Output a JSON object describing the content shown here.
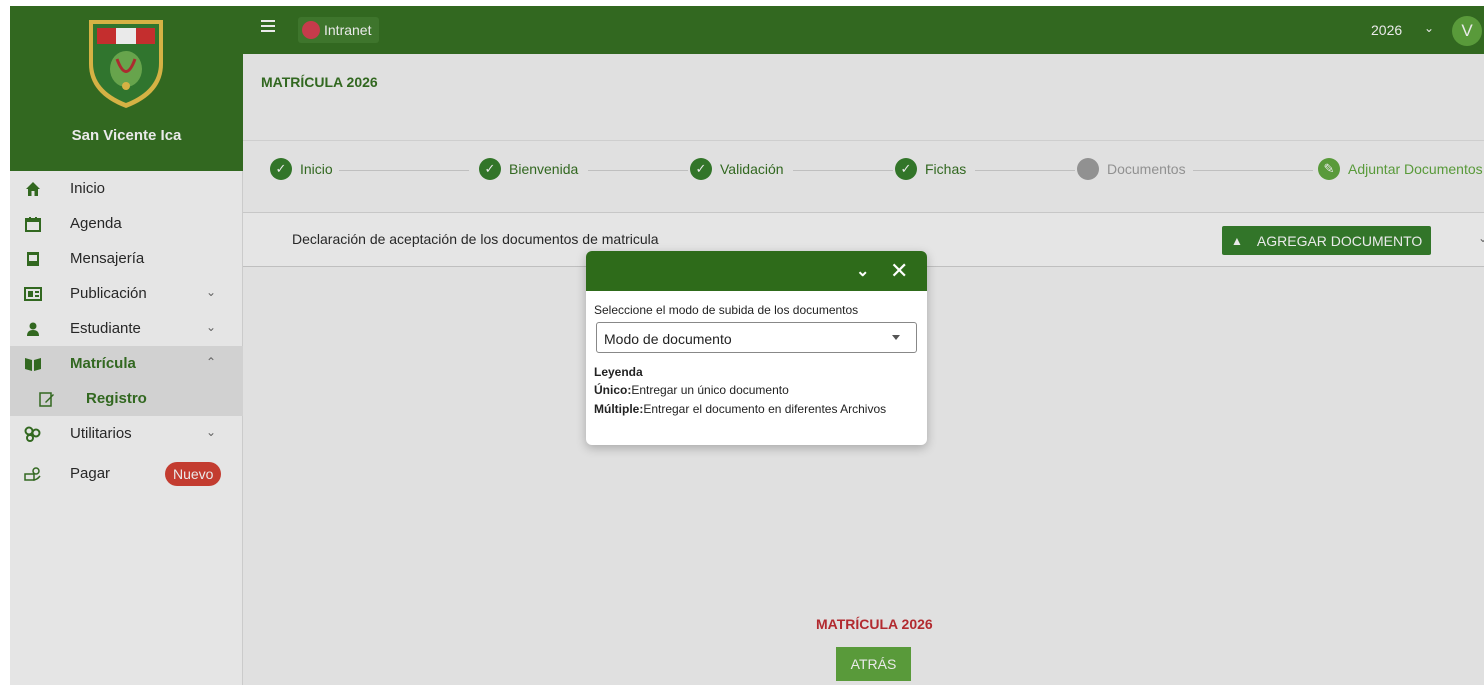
{
  "app": {
    "school_name": "San Vicente Ica",
    "intranet_label": "Intranet",
    "year": "2026",
    "avatar_initial": "V"
  },
  "sidebar": {
    "items": [
      {
        "label": "Inicio",
        "icon": "home-icon"
      },
      {
        "label": "Agenda",
        "icon": "calendar-icon"
      },
      {
        "label": "Mensajería",
        "icon": "mail-icon"
      },
      {
        "label": "Publicación",
        "icon": "news-icon"
      },
      {
        "label": "Estudiante",
        "icon": "student-icon"
      },
      {
        "label": "Matrícula",
        "icon": "book-icon"
      },
      {
        "label": "Registro",
        "icon": "edit-icon"
      },
      {
        "label": "Utilitarios",
        "icon": "tools-icon"
      },
      {
        "label": "Pagar",
        "icon": "payment-icon"
      }
    ],
    "pay_badge": "Nuevo"
  },
  "page": {
    "title": "MATRÍCULA 2026",
    "footer_title": "MATRÍCULA 2026",
    "back_button": "ATRÁS"
  },
  "steps": [
    {
      "label": "Inicio",
      "status": "done"
    },
    {
      "label": "Bienvenida",
      "status": "done"
    },
    {
      "label": "Validación",
      "status": "done"
    },
    {
      "label": "Fichas",
      "status": "done"
    },
    {
      "label": "Documentos",
      "status": "pending"
    },
    {
      "label": "Adjuntar Documentos",
      "status": "current"
    }
  ],
  "document_row": {
    "text": "Declaración de aceptación de los documentos de matricula",
    "add_button": "AGREGAR DOCUMENTO"
  },
  "modal": {
    "prompt": "Seleccione el modo de subida de los documentos",
    "select_value": "Modo de documento",
    "legend_title": "Leyenda",
    "legend": [
      {
        "term": "Único:",
        "desc": "Entregar un único documento"
      },
      {
        "term": "Múltiple:",
        "desc": "Entregar el documento en diferentes Archivos"
      }
    ]
  },
  "colors": {
    "brand_green": "#2e6b1a",
    "accent_green": "#5aa437",
    "badge_red": "#d33a2c",
    "footer_red": "#c0252b"
  }
}
